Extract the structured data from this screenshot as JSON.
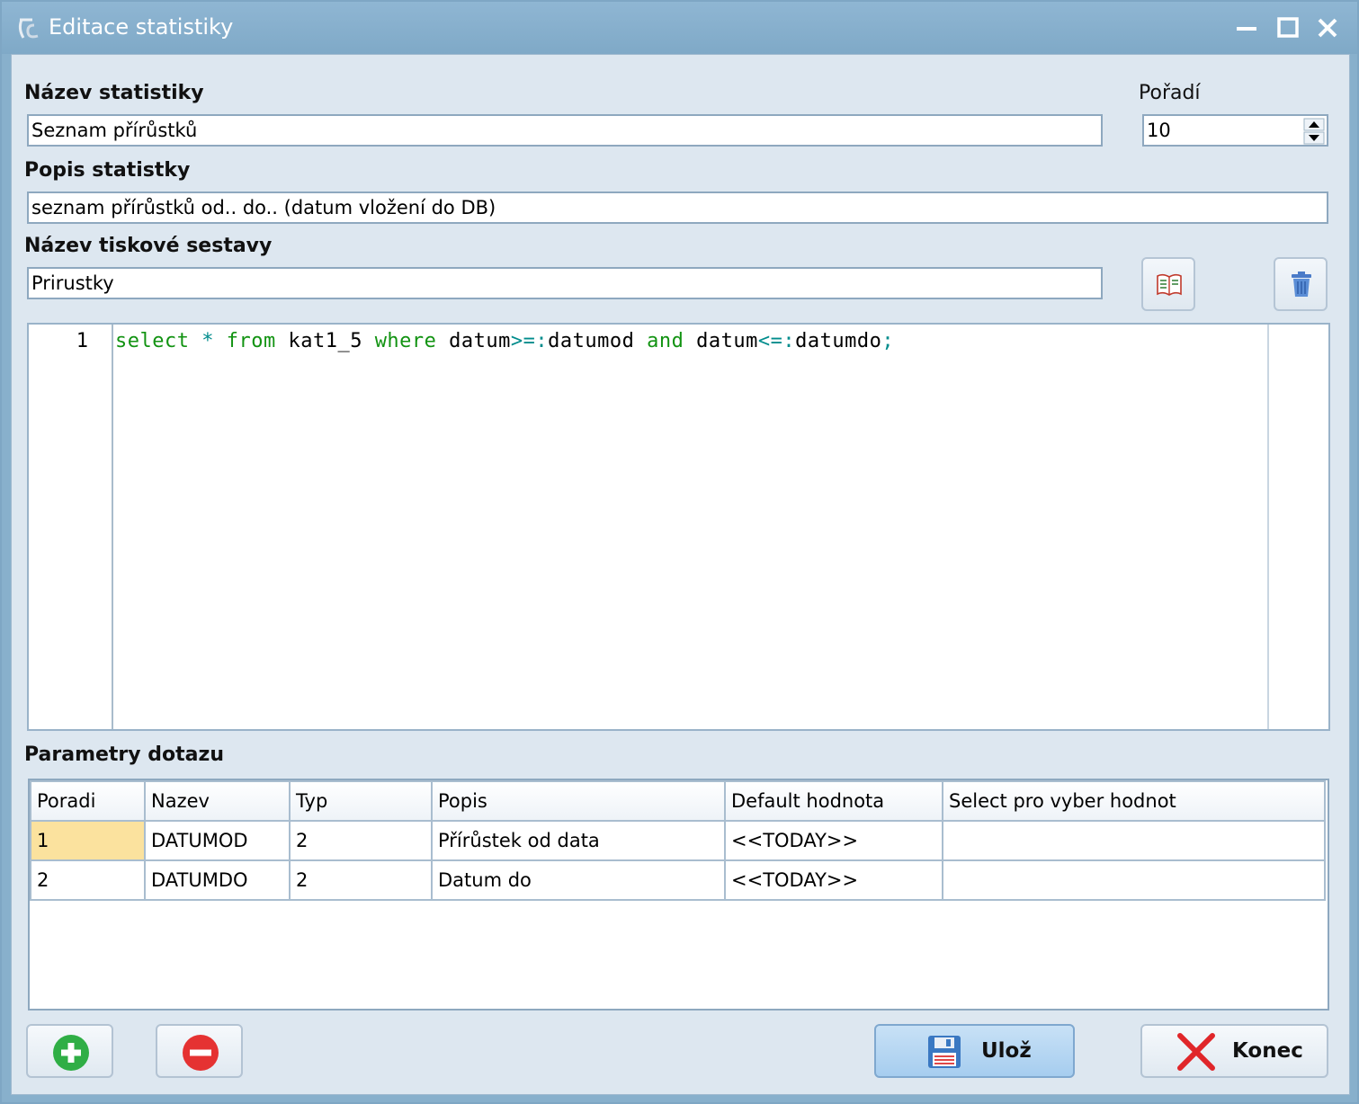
{
  "window": {
    "title": "Editace statistiky"
  },
  "form": {
    "name_label": "Název statistiky",
    "name_value": "Seznam přírůstků",
    "order_label": "Pořadí",
    "order_value": "10",
    "desc_label": "Popis statistky",
    "desc_value": "seznam přírůstků od.. do.. (datum vložení do DB)",
    "report_label": "Název tiskové sestavy",
    "report_value": "Prirustky"
  },
  "editor": {
    "line_number": "1",
    "tokens": [
      "select",
      " ",
      "*",
      " ",
      "from",
      " kat1_5 ",
      "where",
      " datum",
      ">=:",
      "datumod ",
      "and",
      " datum",
      "<=:",
      "datumdo",
      ";"
    ]
  },
  "params": {
    "label": "Parametry dotazu",
    "columns": [
      "Poradi",
      "Nazev",
      "Typ",
      "Popis",
      "Default hodnota",
      "Select pro vyber hodnot"
    ],
    "rows": [
      [
        "1",
        "DATUMOD",
        "2",
        "Přírůstek od data",
        "<<TODAY>>",
        ""
      ],
      [
        "2",
        "DATUMDO",
        "2",
        "Datum do",
        "<<TODAY>>",
        ""
      ]
    ]
  },
  "buttons": {
    "save": "Ulož",
    "close": "Konec"
  },
  "icons": [
    "app-logo-icon",
    "minimize-icon",
    "maximize-icon",
    "close-icon",
    "spin-up-icon",
    "spin-down-icon",
    "report-designer-icon",
    "trash-icon",
    "add-icon",
    "remove-icon",
    "floppy-disk-icon",
    "red-x-icon"
  ]
}
